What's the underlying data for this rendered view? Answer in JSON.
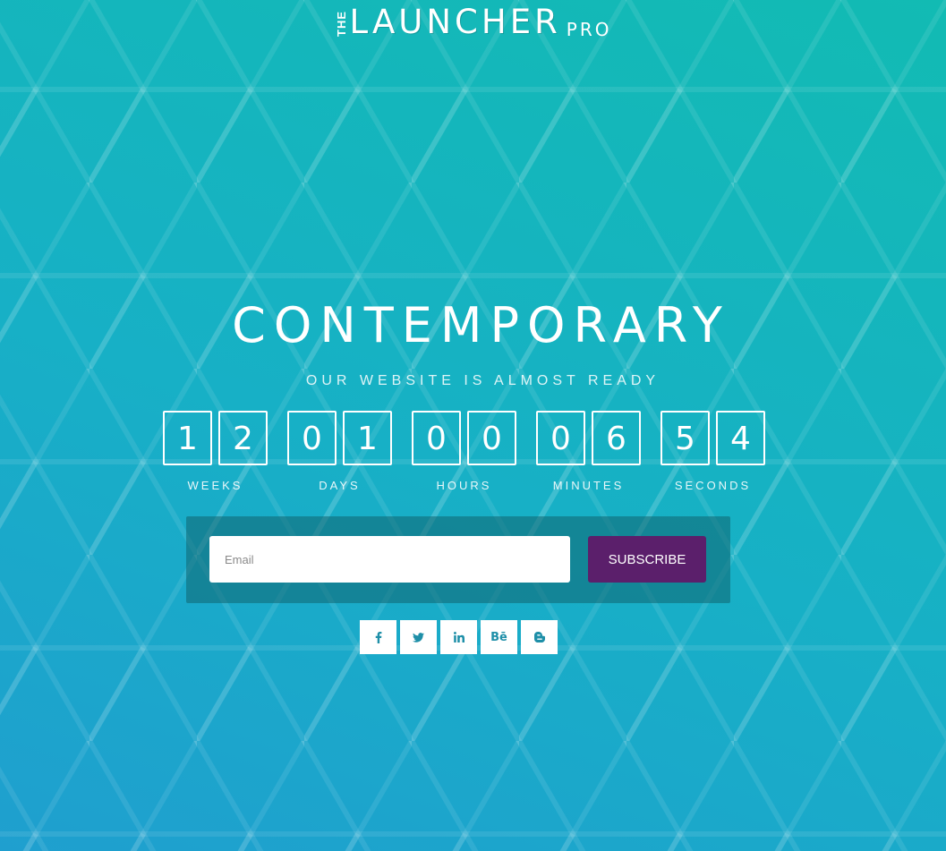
{
  "brand": {
    "the": "THE",
    "name": "LAUNCHER",
    "suffix": "PRO"
  },
  "headline": "CONTEMPORARY",
  "tagline": "OUR WEBSITE IS ALMOST READY",
  "countdown": [
    {
      "label": "WEEKS",
      "digits": [
        "1",
        "2"
      ]
    },
    {
      "label": "DAYS",
      "digits": [
        "0",
        "1"
      ]
    },
    {
      "label": "HOURS",
      "digits": [
        "0",
        "0"
      ]
    },
    {
      "label": "MINUTES",
      "digits": [
        "0",
        "6"
      ]
    },
    {
      "label": "SECONDS",
      "digits": [
        "5",
        "4"
      ]
    }
  ],
  "subscribe": {
    "email_placeholder": "Email",
    "button_label": "SUBSCRIBE"
  },
  "social": {
    "behance_text": "Bē",
    "icons": [
      "facebook-icon",
      "twitter-icon",
      "linkedin-icon",
      "behance-icon",
      "blogger-icon"
    ]
  },
  "colors": {
    "gradient_start": "#1f9fcf",
    "gradient_end": "#12bbb3",
    "subscribe_button": "#5b1f6b",
    "social_icon": "#1e8fa8"
  }
}
